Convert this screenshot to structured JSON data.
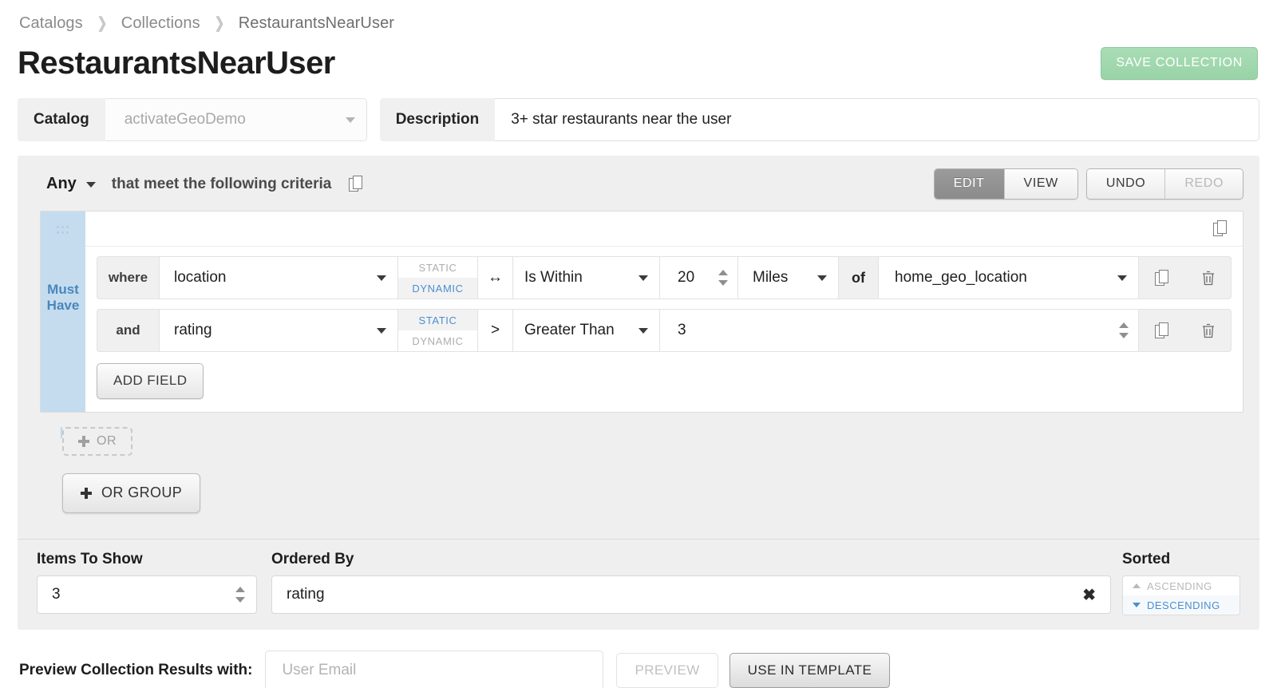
{
  "breadcrumb": {
    "items": [
      "Catalogs",
      "Collections",
      "RestaurantsNearUser"
    ]
  },
  "header": {
    "title": "RestaurantsNearUser",
    "save_label": "SAVE COLLECTION",
    "save_color": "#a9ddb5"
  },
  "meta": {
    "catalog_label": "Catalog",
    "catalog_value": "activateGeoDemo",
    "description_label": "Description",
    "description_value": "3+ star restaurants near the user"
  },
  "builder": {
    "match_mode": "Any",
    "criteria_text": "that meet the following criteria",
    "mode_toggle": {
      "edit": "EDIT",
      "view": "VIEW",
      "active": "EDIT"
    },
    "history": {
      "undo": "UNDO",
      "redo": "REDO",
      "redo_disabled": true
    },
    "group": {
      "must_have_label": "Must Have",
      "add_field_label": "ADD FIELD",
      "conditions": [
        {
          "conjunction": "where",
          "field": "location",
          "value_mode": {
            "static": "STATIC",
            "dynamic": "DYNAMIC",
            "selected": "DYNAMIC"
          },
          "operator_icon": "↔",
          "operator": "Is Within",
          "number": "20",
          "unit": "Miles",
          "of_label": "of",
          "target": "home_geo_location"
        },
        {
          "conjunction": "and",
          "field": "rating",
          "value_mode": {
            "static": "STATIC",
            "dynamic": "DYNAMIC",
            "selected": "STATIC"
          },
          "operator_icon": ">",
          "operator": "Greater Than",
          "number": "3"
        }
      ]
    },
    "or_label": "OR",
    "or_group_label": "OR GROUP"
  },
  "settings": {
    "items_to_show_label": "Items To Show",
    "items_to_show_value": "3",
    "ordered_by_label": "Ordered By",
    "ordered_by_value": "rating",
    "sorted_label": "Sorted",
    "sort_options": {
      "ascending": "ASCENDING",
      "descending": "DESCENDING",
      "selected": "DESCENDING"
    }
  },
  "preview": {
    "label": "Preview Collection Results with:",
    "email_placeholder": "User Email",
    "email_value": "",
    "preview_button": "PREVIEW",
    "preview_disabled": true,
    "use_in_template_button": "USE IN TEMPLATE"
  }
}
